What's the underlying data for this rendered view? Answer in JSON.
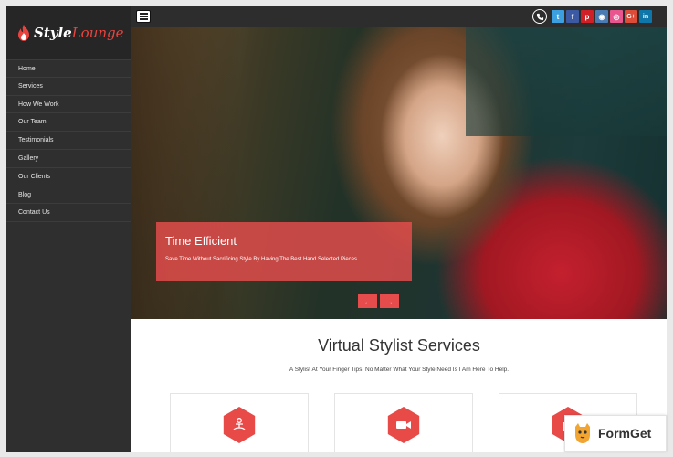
{
  "logo": {
    "word1": "Style",
    "word2": "Lounge"
  },
  "sidebar": {
    "items": [
      {
        "label": "Home"
      },
      {
        "label": "Services"
      },
      {
        "label": "How We Work"
      },
      {
        "label": "Our Team"
      },
      {
        "label": "Testimonials"
      },
      {
        "label": "Gallery"
      },
      {
        "label": "Our Clients"
      },
      {
        "label": "Blog"
      },
      {
        "label": "Contact Us"
      }
    ]
  },
  "topbar": {
    "social": [
      {
        "icon": "twitter-icon",
        "glyph": "t",
        "color": "#3b9fe0"
      },
      {
        "icon": "facebook-icon",
        "glyph": "f",
        "color": "#3b5aa3"
      },
      {
        "icon": "pinterest-icon",
        "glyph": "p",
        "color": "#cf2027"
      },
      {
        "icon": "instagram-icon",
        "glyph": "◉",
        "color": "#4b7bb3"
      },
      {
        "icon": "dribbble-icon",
        "glyph": "◎",
        "color": "#e9558f"
      },
      {
        "icon": "google-plus-icon",
        "glyph": "G+",
        "color": "#dd4b39"
      },
      {
        "icon": "linkedin-icon",
        "glyph": "in",
        "color": "#0e76a8"
      }
    ]
  },
  "hero": {
    "caption_title": "Time Efficient",
    "caption_text": "Save Time Without Sacrificing Style By Having The Best Hand Selected Pieces",
    "prev": "←",
    "next": "→"
  },
  "services": {
    "title": "Virtual Stylist Services",
    "subtitle": "A Stylist At Your Finger Tips! No Matter What Your Style Need Is I Am Here To Help."
  },
  "badge": {
    "text": "FormGet"
  },
  "colors": {
    "accent": "#e84a48",
    "sidebar": "#2f2f2f"
  }
}
